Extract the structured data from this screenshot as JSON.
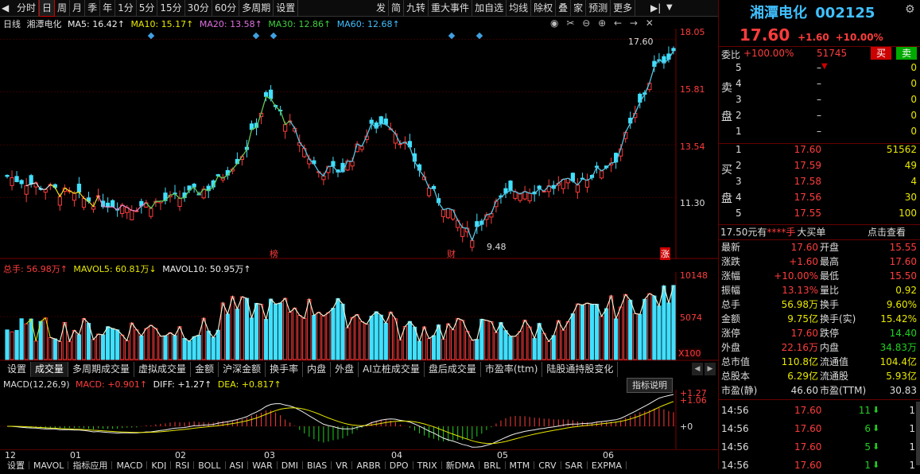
{
  "toolbar": {
    "left_tabs": [
      "分时",
      "日",
      "周",
      "月",
      "季",
      "年",
      "1分",
      "5分",
      "15分",
      "30分",
      "60分",
      "多周期",
      "设置"
    ],
    "active_tab": "日",
    "right_tabs": [
      "发",
      "简",
      "九转",
      "重大事件",
      "加自选",
      "均线",
      "除权",
      "叠",
      "家",
      "预测",
      "更多"
    ]
  },
  "chart_header": {
    "period": "日线",
    "name": "湘潭电化",
    "ma5": "MA5: 16.42↑",
    "ma10": "MA10: 15.17↑",
    "ma20": "MA20: 13.58↑",
    "ma30": "MA30: 12.86↑",
    "ma60": "MA60: 12.68↑",
    "high_label": "17.60",
    "low_label": "9.48",
    "event_1": "榜",
    "event_2": "财",
    "event_3": "涨",
    "price_axis": [
      "18.05",
      "15.81",
      "13.54",
      "11.30"
    ]
  },
  "volume_header": {
    "total": "总手: 56.98万↑",
    "mavol5": "MAVOL5: 60.81万↓",
    "mavol10": "MAVOL10: 50.95万↑",
    "axis": [
      "10148",
      "5074",
      "X100"
    ]
  },
  "bottom_tabs": [
    "设置",
    "成交量",
    "多周期成交量",
    "虚拟成交量",
    "金额",
    "沪深金额",
    "换手率",
    "内盘",
    "外盘",
    "AI立桩成交量",
    "盘后成交量",
    "市盈率(ttm)",
    "陆股通持股变化"
  ],
  "bottom_tabs_active": "成交量",
  "macd_header": {
    "name": "MACD(12,26,9)",
    "macd": "MACD: +0.901↑",
    "diff": "DIFF: +1.27↑",
    "dea": "DEA: +0.817↑",
    "button": "指标说明",
    "axis": [
      "+1.27",
      "+1.06",
      "+0"
    ]
  },
  "x_axis": [
    "12",
    "01",
    "02",
    "03",
    "04",
    "05",
    "06"
  ],
  "indicator_tabs": [
    "设置",
    "MAVOL",
    "指标应用",
    "MACD",
    "KDJ",
    "RSI",
    "BOLL",
    "ASI",
    "WAR",
    "DMI",
    "BIAS",
    "VR",
    "ARBR",
    "DPO",
    "TRIX",
    "新DMA",
    "BRL",
    "MTM",
    "CRV",
    "SAR",
    "EXPMA"
  ],
  "stock": {
    "name": "湘潭电化",
    "code": "002125",
    "price": "17.60",
    "change": "+1.60",
    "pct": "+10.00%"
  },
  "order_book": {
    "wei_bi_label": "委比",
    "wei_bi": "+100.00%",
    "wei_cha": "51745",
    "sell_btn": "买",
    "buy_btn": "卖",
    "sell_side_label": [
      "卖",
      "盘"
    ],
    "buy_side_label": [
      "买",
      "盘"
    ],
    "sells": [
      {
        "lvl": "5",
        "price": "–",
        "vol": "0"
      },
      {
        "lvl": "4",
        "price": "–",
        "vol": "0"
      },
      {
        "lvl": "3",
        "price": "–",
        "vol": "0"
      },
      {
        "lvl": "2",
        "price": "–",
        "vol": "0"
      },
      {
        "lvl": "1",
        "price": "–",
        "vol": "0"
      }
    ],
    "buys": [
      {
        "lvl": "1",
        "price": "17.60",
        "vol": "51562"
      },
      {
        "lvl": "2",
        "price": "17.59",
        "vol": "49"
      },
      {
        "lvl": "3",
        "price": "17.58",
        "vol": "4"
      },
      {
        "lvl": "4",
        "price": "17.56",
        "vol": "30"
      },
      {
        "lvl": "5",
        "price": "17.55",
        "vol": "100"
      }
    ]
  },
  "promo": {
    "text1": "17.50元有",
    "text2": "****手",
    "text3": "大买单",
    "link": "点击查看"
  },
  "quote": [
    {
      "l1": "最新",
      "v1": "17.60",
      "l2": "开盘",
      "v2": "15.55"
    },
    {
      "l1": "涨跌",
      "v1": "+1.60",
      "l2": "最高",
      "v2": "17.60"
    },
    {
      "l1": "涨幅",
      "v1": "+10.00%",
      "l2": "最低",
      "v2": "15.50"
    },
    {
      "l1": "振幅",
      "v1": "13.13%",
      "l2": "量比",
      "v2": "0.92"
    },
    {
      "l1": "总手",
      "v1": "56.98万",
      "l2": "换手",
      "v2": "9.60%"
    },
    {
      "l1": "金额",
      "v1": "9.75亿",
      "l2": "换手(实)",
      "v2": "15.42%"
    },
    {
      "l1": "涨停",
      "v1": "17.60",
      "l2": "跌停",
      "v2": "14.40"
    },
    {
      "l1": "外盘",
      "v1": "22.16万",
      "l2": "内盘",
      "v2": "34.83万"
    },
    {
      "l1": "总市值",
      "v1": "110.8亿",
      "l2": "流通值",
      "v2": "104.4亿"
    },
    {
      "l1": "总股本",
      "v1": "6.29亿",
      "l2": "流通股",
      "v2": "5.93亿"
    },
    {
      "l1": "市盈(静)",
      "v1": "46.60",
      "l2": "市盈(TTM)",
      "v2": "30.83"
    }
  ],
  "ticks": [
    {
      "time": "14:56",
      "price": "17.60",
      "vol": "11",
      "n": "1"
    },
    {
      "time": "14:56",
      "price": "17.60",
      "vol": "6",
      "n": "1"
    },
    {
      "time": "14:56",
      "price": "17.60",
      "vol": "5",
      "n": "1"
    },
    {
      "time": "14:56",
      "price": "17.60",
      "vol": "1",
      "n": "1"
    }
  ],
  "colors": {
    "up": "#ff3c3c",
    "down": "#40e0ff",
    "yellow": "#e8e800",
    "bg": "#000000"
  }
}
